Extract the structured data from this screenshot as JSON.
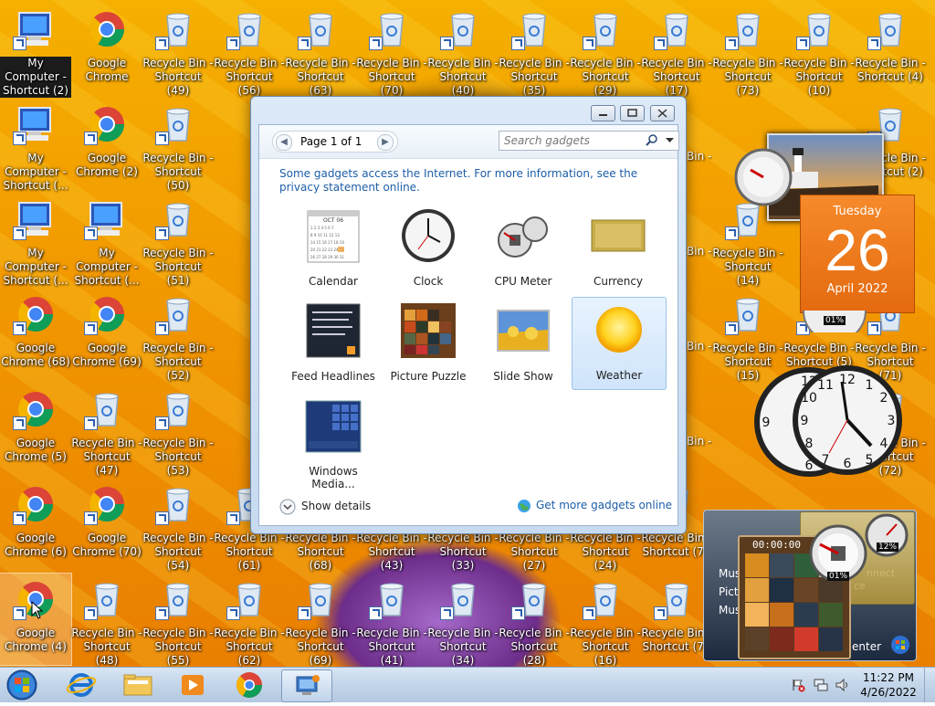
{
  "desktop_icons": {
    "col0": [
      "My Computer - Shortcut (2)",
      "My Computer - Shortcut (...",
      "My Computer - Shortcut (...",
      "Google Chrome (68)",
      "Google Chrome (5)",
      "Google Chrome (6)",
      "Google Chrome (4)"
    ],
    "col1": [
      "Google Chrome",
      "Google Chrome (2)",
      "My Computer - Shortcut (...",
      "Google Chrome (69)",
      "Recycle Bin - Shortcut (47)",
      "Google Chrome (70)",
      "Recycle Bin - Shortcut (48)"
    ],
    "col2": [
      "Recycle Bin - Shortcut (49)",
      "Recycle Bin - Shortcut (50)",
      "Recycle Bin - Shortcut (51)",
      "Recycle Bin - Shortcut (52)",
      "Recycle Bin - Shortcut (53)",
      "Recycle Bin - Shortcut (54)",
      "Recycle Bin - Shortcut (55)"
    ],
    "top_row": [
      "Recycle Bin - Shortcut (56)",
      "Recycle Bin - Shortcut (63)",
      "Recycle Bin - Shortcut (70)",
      "Recycle Bin - Shortcut (40)",
      "Recycle Bin - Shortcut (35)",
      "Recycle Bin - Shortcut (29)",
      "Recycle Bin - Shortcut (17)",
      "Recycle Bin - Shortcut (73)",
      "Recycle Bin - Shortcut (10)",
      "Recycle Bin - Shortcut (4)"
    ],
    "bottom_row_a": [
      "Recycle Bin - Shortcut (61)",
      "Recycle Bin - Shortcut (68)",
      "Recycle Bin - Shortcut (43)",
      "Recycle Bin - Shortcut (33)",
      "Recycle Bin - Shortcut (27)",
      "Recycle Bin - Shortcut (24)",
      "Recycle Bin - Shortcut (76"
    ],
    "bottom_row_b": [
      "Recycle Bin - Shortcut (62)",
      "Recycle Bin - Shortcut (69)",
      "Recycle Bin - Shortcut (41)",
      "Recycle Bin - Shortcut (34)",
      "Recycle Bin - Shortcut (28)",
      "Recycle Bin - Shortcut (16)",
      "Recycle Bin - Shortcut (77"
    ],
    "right_col": [
      "Recycle Bin - Shortcut (2)",
      "Recycle Bin - Shortcut (5)",
      "Recycle Bin - Shortcut (71)",
      "Recycle Bin - Shortcut (72)"
    ],
    "mid_right": [
      "Recycle Bin - Shortcut (14)",
      "Recycle Bin - Shortcut (15)"
    ],
    "partials": [
      "Bin - (18)",
      "Bin - (19)",
      "Bin - (74)",
      "Bin - (75)",
      "Bin - (2)"
    ]
  },
  "gadget_window": {
    "pager_label": "Page 1 of 1",
    "search_placeholder": "Search gadgets",
    "notice": "Some gadgets access the Internet.  For more information, see the privacy statement online.",
    "gadgets": [
      {
        "label": "Calendar",
        "icon": "calendar-gadget-icon"
      },
      {
        "label": "Clock",
        "icon": "clock-gadget-icon"
      },
      {
        "label": "CPU Meter",
        "icon": "cpu-meter-gadget-icon"
      },
      {
        "label": "Currency",
        "icon": "currency-gadget-icon"
      },
      {
        "label": "Feed Headlines",
        "icon": "feed-headlines-gadget-icon"
      },
      {
        "label": "Picture Puzzle",
        "icon": "picture-puzzle-gadget-icon"
      },
      {
        "label": "Slide Show",
        "icon": "slide-show-gadget-icon"
      },
      {
        "label": "Weather",
        "icon": "weather-gadget-icon"
      },
      {
        "label": "Windows Media...",
        "icon": "windows-media-gadget-icon"
      }
    ],
    "calendar_thumb_month": "OCT 06",
    "show_details": "Show details",
    "get_more": "Get more gadgets online"
  },
  "desktop_gadgets": {
    "calendar_day": "Tuesday",
    "calendar_date": "26",
    "calendar_month": "April 2022",
    "cpu_pct_1": "01%",
    "cpu_pct_2": "12%",
    "cpu_pct_3": "01%",
    "media_time": "00:00:00",
    "media_items": [
      "Mus",
      "Pict",
      "Mus"
    ],
    "media_connect": "nnect",
    "media_center": "enter",
    "media_ce": "ce"
  },
  "taskbar": {
    "time": "11:22 PM",
    "date": "4/26/2022"
  },
  "colors": {
    "accent": "#f07a1c",
    "link": "#1d5ea8"
  }
}
